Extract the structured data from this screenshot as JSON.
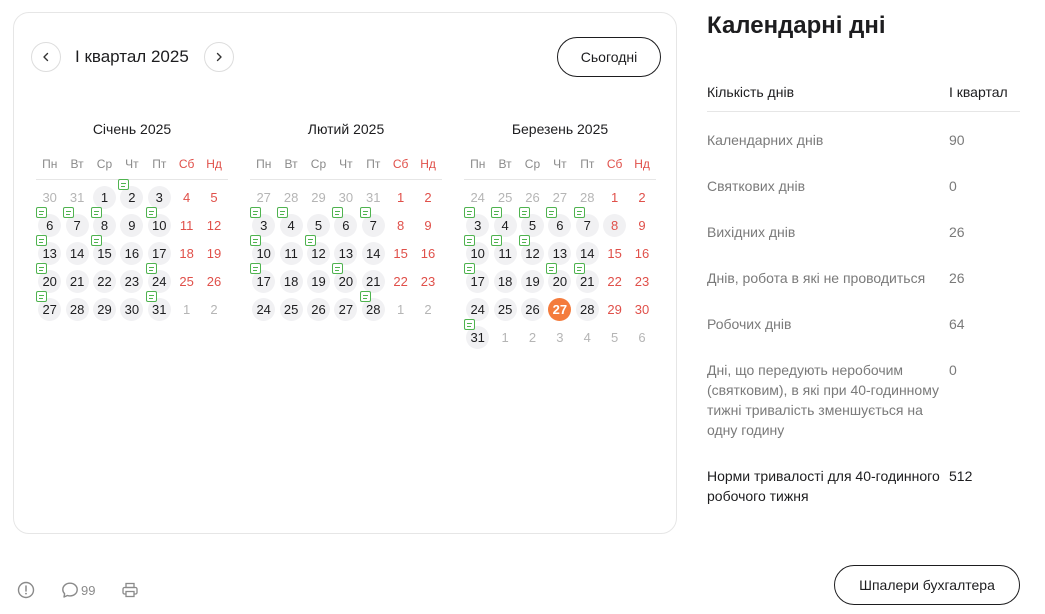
{
  "calendar": {
    "period_title": "І квартал 2025",
    "prev_icon": "chevron-left-icon",
    "next_icon": "chevron-right-icon",
    "today_label": "Сьогодні",
    "weekdays": [
      "Пн",
      "Вт",
      "Ср",
      "Чт",
      "Пт",
      "Сб",
      "Нд"
    ],
    "weekend_color": "#e0504a",
    "today_color": "#f47b3c",
    "note_icon_color": "#4fb34f",
    "months": [
      {
        "title": "Січень 2025",
        "weeks": [
          [
            {
              "d": "30",
              "o": 1
            },
            {
              "d": "31",
              "o": 1
            },
            {
              "d": "1",
              "s": 1
            },
            {
              "d": "2",
              "n": 1
            },
            {
              "d": "3",
              "s": 1
            },
            {
              "d": "4"
            },
            {
              "d": "5"
            }
          ],
          [
            {
              "d": "6",
              "n": 1
            },
            {
              "d": "7",
              "n": 1
            },
            {
              "d": "8",
              "n": 1
            },
            {
              "d": "9"
            },
            {
              "d": "10",
              "n": 1
            },
            {
              "d": "11"
            },
            {
              "d": "12"
            }
          ],
          [
            {
              "d": "13",
              "n": 1
            },
            {
              "d": "14"
            },
            {
              "d": "15",
              "n": 1
            },
            {
              "d": "16"
            },
            {
              "d": "17"
            },
            {
              "d": "18"
            },
            {
              "d": "19"
            }
          ],
          [
            {
              "d": "20",
              "n": 1
            },
            {
              "d": "21"
            },
            {
              "d": "22"
            },
            {
              "d": "23"
            },
            {
              "d": "24",
              "n": 1
            },
            {
              "d": "25"
            },
            {
              "d": "26"
            }
          ],
          [
            {
              "d": "27",
              "n": 1
            },
            {
              "d": "28"
            },
            {
              "d": "29"
            },
            {
              "d": "30"
            },
            {
              "d": "31",
              "n": 1
            },
            {
              "d": "1",
              "o": 1
            },
            {
              "d": "2",
              "o": 1
            }
          ]
        ]
      },
      {
        "title": "Лютий 2025",
        "weeks": [
          [
            {
              "d": "27",
              "o": 1
            },
            {
              "d": "28",
              "o": 1
            },
            {
              "d": "29",
              "o": 1
            },
            {
              "d": "30",
              "o": 1
            },
            {
              "d": "31",
              "o": 1
            },
            {
              "d": "1"
            },
            {
              "d": "2"
            }
          ],
          [
            {
              "d": "3",
              "n": 1
            },
            {
              "d": "4",
              "n": 1
            },
            {
              "d": "5"
            },
            {
              "d": "6",
              "n": 1
            },
            {
              "d": "7",
              "n": 1
            },
            {
              "d": "8"
            },
            {
              "d": "9"
            }
          ],
          [
            {
              "d": "10",
              "n": 1
            },
            {
              "d": "11"
            },
            {
              "d": "12",
              "n": 1
            },
            {
              "d": "13"
            },
            {
              "d": "14"
            },
            {
              "d": "15"
            },
            {
              "d": "16"
            }
          ],
          [
            {
              "d": "17",
              "n": 1
            },
            {
              "d": "18"
            },
            {
              "d": "19"
            },
            {
              "d": "20",
              "n": 1
            },
            {
              "d": "21"
            },
            {
              "d": "22"
            },
            {
              "d": "23"
            }
          ],
          [
            {
              "d": "24"
            },
            {
              "d": "25"
            },
            {
              "d": "26"
            },
            {
              "d": "27"
            },
            {
              "d": "28",
              "n": 1
            },
            {
              "d": "1",
              "o": 1
            },
            {
              "d": "2",
              "o": 1
            }
          ]
        ]
      },
      {
        "title": "Березень 2025",
        "weeks": [
          [
            {
              "d": "24",
              "o": 1
            },
            {
              "d": "25",
              "o": 1
            },
            {
              "d": "26",
              "o": 1
            },
            {
              "d": "27",
              "o": 1
            },
            {
              "d": "28",
              "o": 1
            },
            {
              "d": "1"
            },
            {
              "d": "2"
            }
          ],
          [
            {
              "d": "3",
              "n": 1
            },
            {
              "d": "4",
              "n": 1
            },
            {
              "d": "5",
              "n": 1
            },
            {
              "d": "6",
              "n": 1
            },
            {
              "d": "7",
              "n": 1
            },
            {
              "d": "8",
              "s": 1
            },
            {
              "d": "9"
            }
          ],
          [
            {
              "d": "10",
              "n": 1
            },
            {
              "d": "11",
              "n": 1
            },
            {
              "d": "12",
              "n": 1
            },
            {
              "d": "13"
            },
            {
              "d": "14"
            },
            {
              "d": "15"
            },
            {
              "d": "16"
            }
          ],
          [
            {
              "d": "17",
              "n": 1
            },
            {
              "d": "18"
            },
            {
              "d": "19"
            },
            {
              "d": "20",
              "n": 1
            },
            {
              "d": "21",
              "n": 1
            },
            {
              "d": "22"
            },
            {
              "d": "23"
            }
          ],
          [
            {
              "d": "24"
            },
            {
              "d": "25"
            },
            {
              "d": "26"
            },
            {
              "d": "27",
              "t": 1
            },
            {
              "d": "28"
            },
            {
              "d": "29"
            },
            {
              "d": "30"
            }
          ],
          [
            {
              "d": "31",
              "n": 1
            },
            {
              "d": "1",
              "o": 1
            },
            {
              "d": "2",
              "o": 1
            },
            {
              "d": "3",
              "o": 1
            },
            {
              "d": "4",
              "o": 1
            },
            {
              "d": "5",
              "o": 1
            },
            {
              "d": "6",
              "o": 1
            }
          ]
        ]
      }
    ]
  },
  "stats": {
    "title": "Календарні дні",
    "header": {
      "label": "Кількість днів",
      "value": "І квартал"
    },
    "rows": [
      {
        "label": "Календарних днів",
        "value": "90"
      },
      {
        "label": "Святкових днів",
        "value": "0"
      },
      {
        "label": "Вихідних днів",
        "value": "26"
      },
      {
        "label": "Днів, робота в які не проводиться",
        "value": "26"
      },
      {
        "label": "Робочих днів",
        "value": "64"
      },
      {
        "label": "Дні, що передують неробочим (святковим), в які при 40-годинному тижні тривалість зменшується на одну годину",
        "value": "0"
      }
    ],
    "norm": {
      "label": "Норми тривалості для 40-годинного робочого тижня",
      "value": "512"
    }
  },
  "footer": {
    "info_icon": "info-icon",
    "comment_icon": "comment-icon",
    "comments_count": "99",
    "print_icon": "print-icon",
    "wallpaper_label": "Шпалери бухгалтера"
  }
}
